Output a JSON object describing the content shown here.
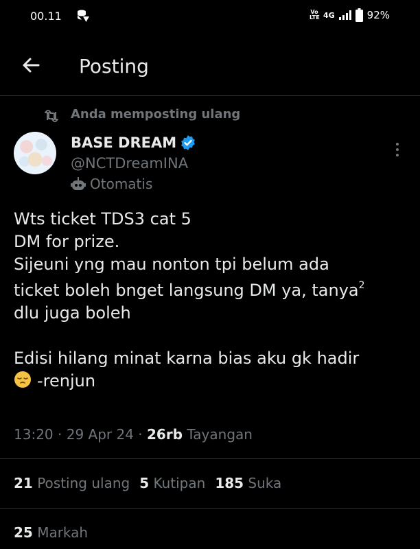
{
  "status_bar": {
    "time": "00.11",
    "volte": "Vo LTE",
    "network": "4G",
    "battery": "92%"
  },
  "header": {
    "title": "Posting"
  },
  "repost": {
    "text": "Anda memposting ulang"
  },
  "author": {
    "name": "BASE DREAM",
    "handle": "@NCTDreamINA",
    "label": "Otomatis"
  },
  "post": {
    "line1": "Wts ticket TDS3 cat 5",
    "line2": "DM for prize.",
    "line3": "Sijeuni yng mau nonton tpi belum ada",
    "line4": "ticket boleh bnget langsung DM ya, tanya",
    "line4_sup": "2",
    "line5": "dlu juga boleh",
    "line6": "Edisi hilang minat karna bias aku gk hadir",
    "line7": "-renjun"
  },
  "meta": {
    "time": "13:20",
    "sep1": " · ",
    "date": "29 Apr 24",
    "sep2": " · ",
    "views_count": "26rb",
    "views_label": " Tayangan"
  },
  "stats": {
    "reposts_count": "21",
    "reposts_label": " Posting ulang",
    "quotes_count": "5",
    "quotes_label": " Kutipan",
    "likes_count": "185",
    "likes_label": " Suka",
    "bookmarks_count": "25",
    "bookmarks_label": " Markah"
  },
  "colors": {
    "background": "#000000",
    "text": "#e7e9ea",
    "secondary": "#71767b",
    "verified": "#1d9bf0",
    "divider": "#2f3336"
  }
}
